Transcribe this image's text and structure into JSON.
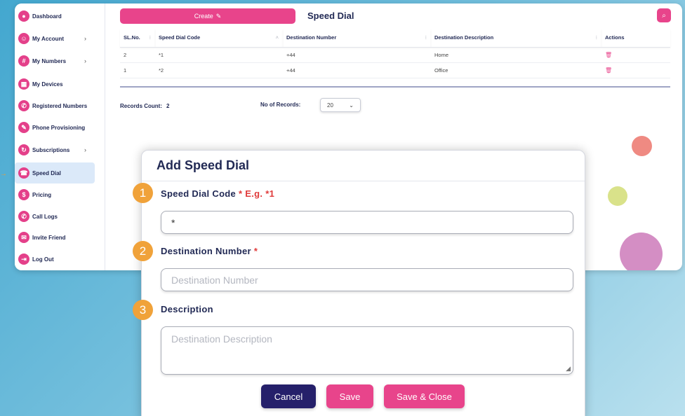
{
  "sidebar": {
    "items": [
      {
        "label": "Dashboard",
        "icon": "user-icon",
        "glyph": "●",
        "chevron": ""
      },
      {
        "label": "My Account",
        "icon": "account-icon",
        "glyph": "☺",
        "chevron": "›"
      },
      {
        "label": "My Numbers",
        "icon": "hash-icon",
        "glyph": "#",
        "chevron": "›"
      },
      {
        "label": "My Devices",
        "icon": "devices-icon",
        "glyph": "▦",
        "chevron": ""
      },
      {
        "label": "Registered Numbers",
        "icon": "phone-icon",
        "glyph": "✆",
        "chevron": ""
      },
      {
        "label": "Phone Provisioning",
        "icon": "wrench-icon",
        "glyph": "✎",
        "chevron": ""
      },
      {
        "label": "Subscriptions",
        "icon": "subscription-icon",
        "glyph": "↻",
        "chevron": "›"
      },
      {
        "label": "Speed Dial",
        "icon": "speed-dial-icon",
        "glyph": "☎",
        "chevron": ""
      },
      {
        "label": "Pricing",
        "icon": "pricing-icon",
        "glyph": "$",
        "chevron": ""
      },
      {
        "label": "Call Logs",
        "icon": "call-log-icon",
        "glyph": "✆",
        "chevron": ""
      },
      {
        "label": "Invite Friend",
        "icon": "invite-icon",
        "glyph": "✉",
        "chevron": ""
      },
      {
        "label": "Log Out",
        "icon": "logout-icon",
        "glyph": "⇥",
        "chevron": ""
      }
    ]
  },
  "header": {
    "create_label": "Create",
    "create_icon": "✎",
    "title": "Speed Dial",
    "search_icon": "⌕"
  },
  "table": {
    "columns": [
      "SL.No.",
      "Speed Dial Code",
      "Destination Number",
      "Destination Description",
      "Actions"
    ],
    "rows": [
      {
        "sl": "2",
        "code": "*1",
        "number": "+44",
        "description": "Home"
      },
      {
        "sl": "1",
        "code": "*2",
        "number": "+44",
        "description": "Office"
      }
    ]
  },
  "footer": {
    "records_label": "Records Count:",
    "records_value": "2",
    "per_page_label": "No of Records:",
    "per_page_value": "20"
  },
  "modal": {
    "title": "Add Speed Dial",
    "fields": [
      {
        "number": "1",
        "label": "Speed Dial Code",
        "required": "* E.g. *1",
        "value": "*",
        "placeholder": ""
      },
      {
        "number": "2",
        "label": "Destination Number",
        "required": "*",
        "value": "",
        "placeholder": "Destination Number"
      },
      {
        "number": "3",
        "label": "Description",
        "required": "",
        "value": "",
        "placeholder": "Destination Description"
      }
    ],
    "buttons": {
      "cancel": "Cancel",
      "save": "Save",
      "save_close": "Save & Close"
    }
  },
  "colors": {
    "accent": "#e8448b",
    "navy": "#222a55",
    "badge": "#f0a23a",
    "cancel": "#25206a",
    "bubble_red": "#ef8a82",
    "bubble_green": "#d9e28a",
    "bubble_purple": "#d48ec4"
  }
}
